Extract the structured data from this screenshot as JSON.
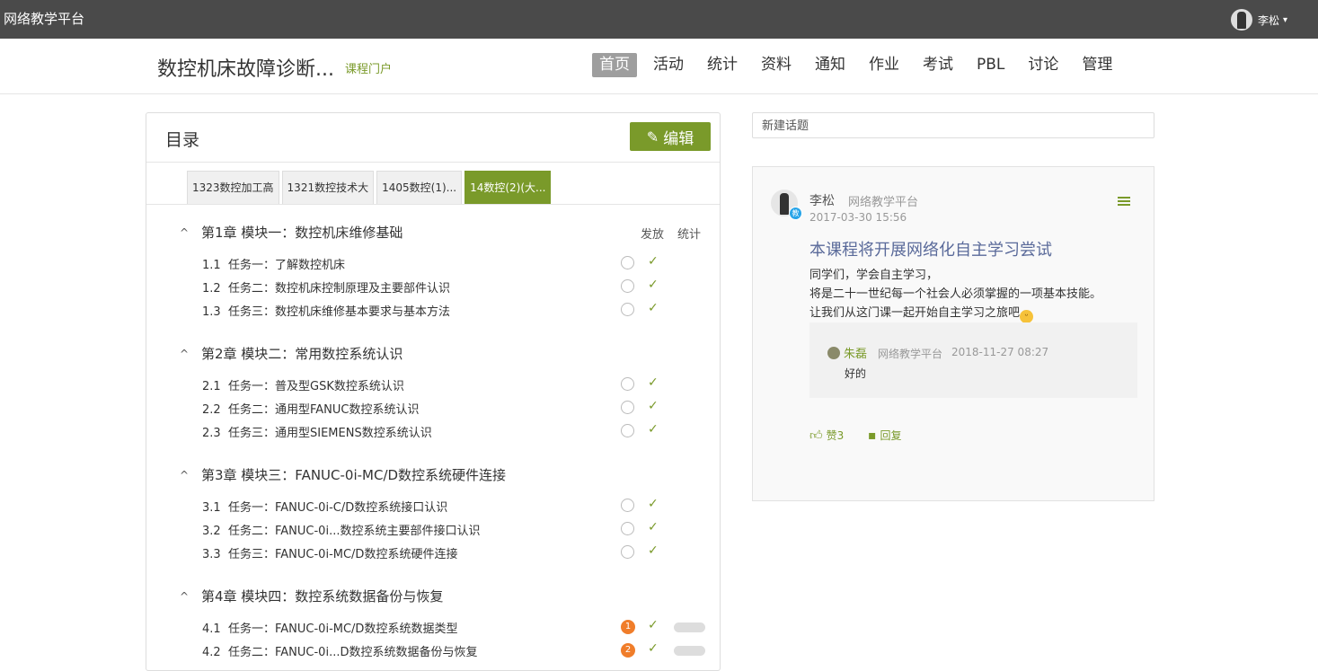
{
  "topbar": {
    "brand": "网络教学平台",
    "user_name": "李松"
  },
  "header": {
    "course_title": "数控机床故障诊断...",
    "portal_link": "课程门户",
    "nav": [
      "首页",
      "活动",
      "统计",
      "资料",
      "通知",
      "作业",
      "考试",
      "PBL",
      "讨论",
      "管理"
    ],
    "active_nav": "首页"
  },
  "catalog": {
    "title": "目录",
    "edit_label": "编辑",
    "tabs": [
      "1323数控加工高",
      "1321数控技术大",
      "1405数控(1)...",
      "14数控(2)(大..."
    ],
    "active_tab": "14数控(2)(大...",
    "col_publish": "发放",
    "col_stats": "统计",
    "chapters": [
      {
        "title": "第1章 模块一：数控机床维修基础",
        "lessons": [
          {
            "num": "1.1",
            "title": "任务一：了解数控机床",
            "badge": ""
          },
          {
            "num": "1.2",
            "title": "任务二：数控机床控制原理及主要部件认识",
            "badge": ""
          },
          {
            "num": "1.3",
            "title": "任务三：数控机床维修基本要求与基本方法",
            "badge": ""
          }
        ]
      },
      {
        "title": "第2章 模块二：常用数控系统认识",
        "lessons": [
          {
            "num": "2.1",
            "title": "任务一：普及型GSK数控系统认识",
            "badge": ""
          },
          {
            "num": "2.2",
            "title": "任务二：通用型FANUC数控系统认识",
            "badge": ""
          },
          {
            "num": "2.3",
            "title": "任务三：通用型SIEMENS数控系统认识",
            "badge": ""
          }
        ]
      },
      {
        "title": "第3章 模块三：FANUC-0i-MC/D数控系统硬件连接",
        "lessons": [
          {
            "num": "3.1",
            "title": "任务一：FANUC-0i-C/D数控系统接口认识",
            "badge": ""
          },
          {
            "num": "3.2",
            "title": "任务二：FANUC-0i...数控系统主要部件接口认识",
            "badge": ""
          },
          {
            "num": "3.3",
            "title": "任务三：FANUC-0i-MC/D数控系统硬件连接",
            "badge": ""
          }
        ]
      },
      {
        "title": "第4章 模块四：数控系统数据备份与恢复",
        "lessons": [
          {
            "num": "4.1",
            "title": "任务一：FANUC-0i-MC/D数控系统数据类型",
            "badge": "1"
          },
          {
            "num": "4.2",
            "title": "任务二：FANUC-0i...D数控系统数据备份与恢复",
            "badge": "2"
          }
        ]
      }
    ]
  },
  "discussion": {
    "new_topic_placeholder": "新建话题",
    "post": {
      "author": "李松",
      "org": "网络教学平台",
      "date": "2017-03-30 15:56",
      "role_badge": "教",
      "title": "本课程将开展网络化自主学习尝试",
      "body_lines": [
        "同学们，学会自主学习，",
        "将是二十一世纪每一个社会人必须掌握的一项基本技能。",
        "让我们从这门课一起开始自主学习之旅吧"
      ],
      "reply": {
        "author": "朱磊",
        "org": "网络教学平台",
        "date": "2018-11-27 08:27",
        "text": "好的"
      },
      "like_label": "赞3",
      "reply_label": "回复"
    }
  },
  "colors": {
    "accent": "#7a9a2a",
    "topbar": "#4a4a4a",
    "badge": "#f07d2a",
    "role": "#27a4e8"
  }
}
